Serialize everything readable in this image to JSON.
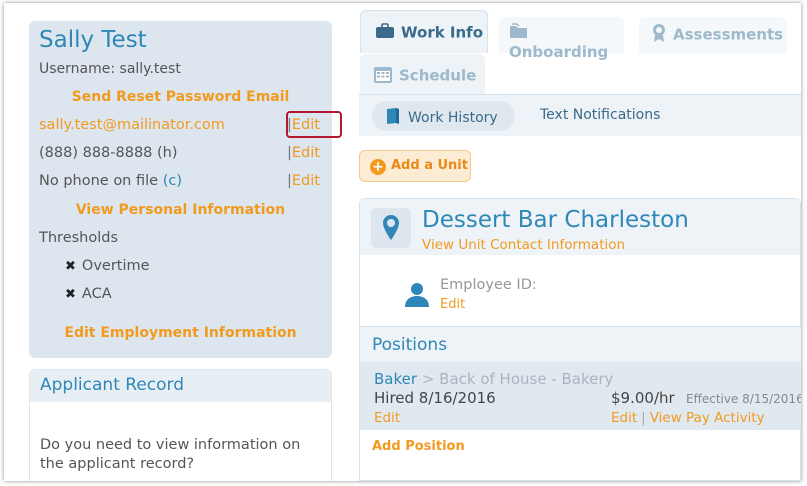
{
  "profile": {
    "name": "Sally Test",
    "username": "Username: sally.test",
    "reset_password": "Send Reset Password Email",
    "email": "sally.test@mailinator.com",
    "phone": "(888) 888-8888 (h)",
    "no_phone": "No phone on file",
    "no_phone_c": "(c)",
    "edit_label": "Edit",
    "edit_separator": "|",
    "view_personal": "View Personal Information",
    "thresholds_label": "Thresholds",
    "thresholds": [
      {
        "label": "Overtime"
      },
      {
        "label": "ACA"
      }
    ],
    "edit_employment": "Edit Employment Information"
  },
  "applicant": {
    "title": "Applicant Record",
    "text": "Do you need to view information on the applicant record?"
  },
  "tabs": {
    "work_info": "Work Info",
    "onboarding": "Onboarding",
    "assessments": "Assessments",
    "schedule": "Schedule"
  },
  "subnav": {
    "work_history": "Work History",
    "text_notifications": "Text Notifications"
  },
  "add_unit": "Add a Unit",
  "unit": {
    "name": "Dessert Bar Charleston",
    "contact_link": "View Unit Contact Information",
    "employee_id_label": "Employee ID:",
    "employee_edit": "Edit",
    "positions_title": "Positions",
    "position": {
      "title": "Baker",
      "department": "> Back of House - Bakery",
      "hired": "Hired 8/16/2016",
      "rate": "$9.00/hr",
      "effective": "Effective 8/15/2016",
      "edit": "Edit",
      "rate_edit": "Edit",
      "separator": "|",
      "pay_activity": "View Pay Activity"
    },
    "add_position": "Add Position"
  },
  "colors": {
    "blue": "#2f87b7",
    "orange": "#f19a1e",
    "highlight_red": "#b3192e",
    "panel": "#dde6ee"
  }
}
